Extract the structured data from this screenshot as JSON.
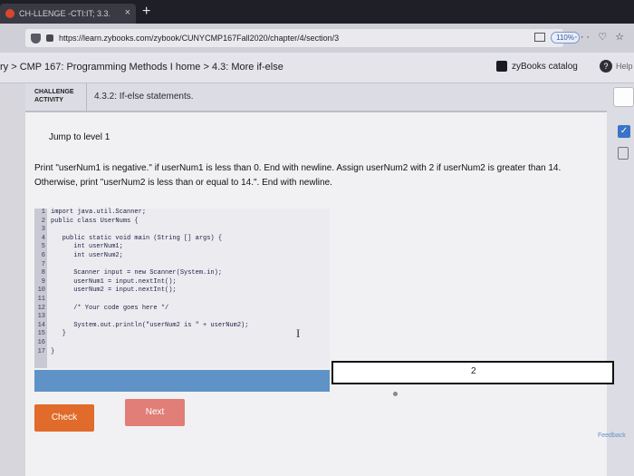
{
  "browser": {
    "tab_title": "CH-LLENGE -CTI:IT; 3.3.",
    "tab_close": "×",
    "new_tab": "+",
    "url": "https://learn.zybooks.com/zybook/CUNYCMP167Fall2020/chapter/4/section/3",
    "zoom": "110%",
    "menu_icons": "··· ♡ ☆"
  },
  "header": {
    "breadcrumb": "ry > CMP 167: Programming Methods I home > 4.3: More if-else",
    "catalog": "zyBooks catalog",
    "help": "Help"
  },
  "activity": {
    "badge_line1": "CHALLENGE",
    "badge_line2": "ACTIVITY",
    "title": "4.3.2: If-else statements.",
    "jump": "Jump to level 1",
    "instructions": "Print \"userNum1 is negative.\" if userNum1 is less than 0. End with newline. Assign userNum2 with 2 if userNum2 is greater than 14. Otherwise, print \"userNum2 is less than or equal to 14.\". End with newline.",
    "line_numbers": [
      "1",
      "2",
      "3",
      "4",
      "5",
      "6",
      "7",
      "8",
      "9",
      "10",
      "11",
      "12",
      "13",
      "14",
      "15",
      "16",
      "17"
    ],
    "code_lines": [
      "import java.util.Scanner;",
      "public class UserNums {",
      "",
      "   public static void main (String [] args) {",
      "      int userNum1;",
      "      int userNum2;",
      "",
      "      Scanner input = new Scanner(System.in);",
      "      userNum1 = input.nextInt();",
      "      userNum2 = input.nextInt();",
      "",
      "      /* Your code goes here */",
      "",
      "      System.out.println(\"userNum2 is \" + userNum2);",
      "   }",
      "",
      "}"
    ],
    "progress_level": "2",
    "check_label": "Check",
    "next_label": "Next",
    "feedback_label": "Feedback"
  }
}
